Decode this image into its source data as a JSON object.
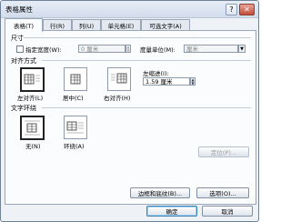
{
  "window": {
    "title": "表格属性",
    "help_glyph": "?",
    "close_glyph": "✕"
  },
  "tabs": [
    {
      "label": "表格(T)",
      "active": true
    },
    {
      "label": "行(R)"
    },
    {
      "label": "列(U)"
    },
    {
      "label": "单元格(E)"
    },
    {
      "label": "可选文字(A)"
    }
  ],
  "size": {
    "heading": "尺寸",
    "preferred_width_label": "指定宽度(W):",
    "preferred_width_value": "0 厘米",
    "measure_in_label": "度量单位(M):",
    "measure_in_value": "厘米"
  },
  "alignment": {
    "heading": "对齐方式",
    "options": [
      {
        "label": "左对齐(L)",
        "selected": true
      },
      {
        "label": "居中(C)"
      },
      {
        "label": "右对齐(H)"
      }
    ],
    "indent_label": "左缩进(I):",
    "indent_value": "1.59 厘米"
  },
  "wrapping": {
    "heading": "文字环绕",
    "options": [
      {
        "label": "无(N)",
        "selected": true
      },
      {
        "label": "环绕(A)"
      }
    ],
    "positioning_button": "定位(P)..."
  },
  "footer": {
    "borders_button": "边框和底纹(B)...",
    "options_button": "选项(O)...",
    "ok_button": "确定",
    "cancel_button": "取消"
  },
  "icons": {
    "spin_up": "▲",
    "spin_down": "▼",
    "dropdown": "▼"
  }
}
